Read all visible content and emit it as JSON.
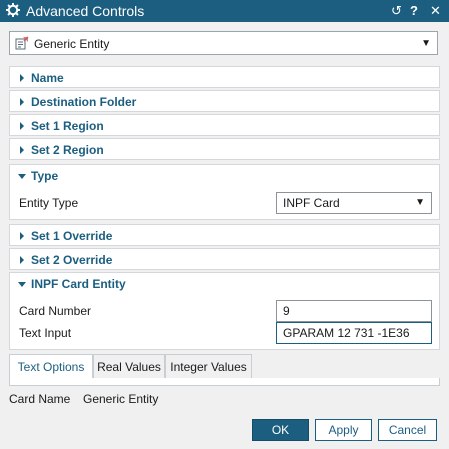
{
  "window": {
    "title": "Advanced Controls",
    "buttons": {
      "reset": "↺",
      "help": "?",
      "close": "✕"
    },
    "icons": [
      "gear-icon",
      "reset-icon",
      "help-icon",
      "close-icon"
    ]
  },
  "entity_selector": {
    "value": "Generic Entity",
    "icon": "generic-entity-icon"
  },
  "sections": {
    "name": {
      "label": "Name",
      "state": "collapsed"
    },
    "destination_folder": {
      "label": "Destination Folder",
      "state": "collapsed"
    },
    "set1_region": {
      "label": "Set 1 Region",
      "state": "collapsed"
    },
    "set2_region": {
      "label": "Set 2 Region",
      "state": "collapsed"
    },
    "type": {
      "label": "Type",
      "state": "expanded",
      "entity_type_label": "Entity Type",
      "entity_type_value": "INPF Card"
    },
    "set1_override": {
      "label": "Set 1 Override",
      "state": "collapsed"
    },
    "set2_override": {
      "label": "Set 2 Override",
      "state": "collapsed"
    },
    "inpf_card_entity": {
      "label": "INPF Card Entity",
      "state": "expanded",
      "card_number_label": "Card Number",
      "card_number_value": "9",
      "text_input_label": "Text Input",
      "text_input_value": "GPARAM 12 731 -1E36"
    }
  },
  "tabs": [
    {
      "label": "Text Options",
      "selected": true
    },
    {
      "label": "Real Values",
      "selected": false
    },
    {
      "label": "Integer Values",
      "selected": false
    }
  ],
  "card_name": {
    "label": "Card Name",
    "value": "Generic Entity"
  },
  "footer": {
    "ok": "OK",
    "apply": "Apply",
    "cancel": "Cancel"
  },
  "colors": {
    "accent": "#1b5e80",
    "background": "#f0f0f0"
  }
}
